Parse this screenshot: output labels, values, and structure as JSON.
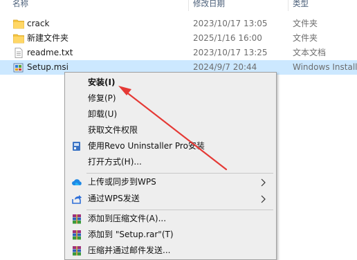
{
  "header": {
    "col_name": "名称",
    "col_date": "修改日期",
    "col_type": "类型"
  },
  "files": [
    {
      "name": "crack",
      "date": "2023/10/17 13:05",
      "type": "文件夹",
      "icon": "folder-icon"
    },
    {
      "name": "新建文件夹",
      "date": "2025/1/16 16:00",
      "type": "文件夹",
      "icon": "folder-icon"
    },
    {
      "name": "readme.txt",
      "date": "2023/10/17 13:25",
      "type": "文本文档",
      "icon": "text-file-icon"
    },
    {
      "name": "Setup.msi",
      "date": "2024/9/7 20:44",
      "type": "Windows Install...",
      "icon": "msi-installer-icon",
      "selected": true
    }
  ],
  "context_menu": {
    "install": "安装(I)",
    "repair": "修复(P)",
    "uninstall": "卸载(U)",
    "take_ownership": "获取文件权限",
    "revo_uninstall": "使用Revo Uninstaller Pro安装",
    "open_with": "打开方式(H)...",
    "upload_wps": "上传或同步到WPS",
    "send_wps": "通过WPS发送",
    "add_to_archive": "添加到压缩文件(A)...",
    "add_to_rar": "添加到 \"Setup.rar\"(T)",
    "compress_email": "压缩并通过邮件发送..."
  },
  "colors": {
    "selection": "#cce8ff",
    "menu_bg": "#eeeeee",
    "annotation_arrow": "#e53935",
    "folder": "#f5c542"
  }
}
